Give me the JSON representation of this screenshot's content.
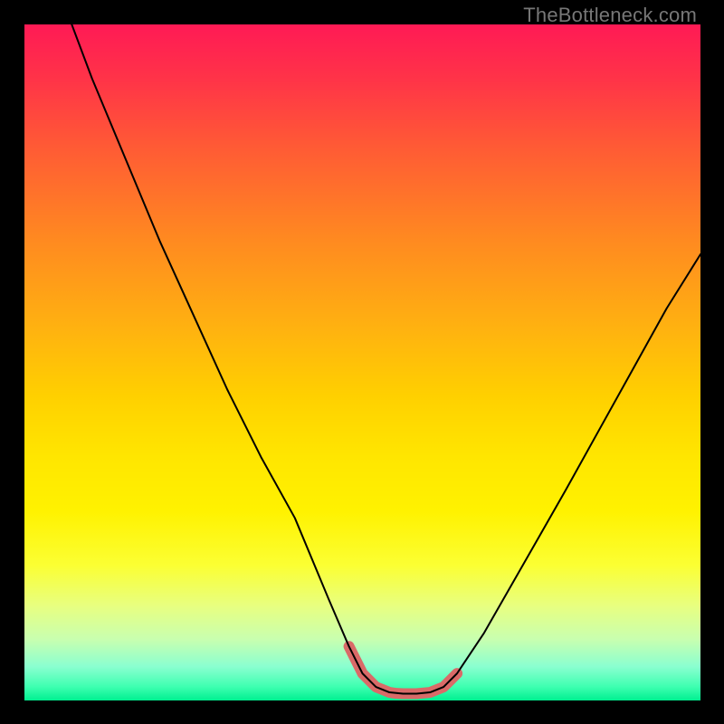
{
  "attribution": "TheBottleneck.com",
  "colors": {
    "frame": "#000000",
    "curve": "#000000",
    "marker": "#d96a68",
    "gradient_top": "#ff1a55",
    "gradient_bottom": "#00f090"
  },
  "chart_data": {
    "type": "line",
    "title": "",
    "xlabel": "",
    "ylabel": "",
    "xlim": [
      0,
      100
    ],
    "ylim": [
      0,
      100
    ],
    "series": [
      {
        "name": "bottleneck-curve",
        "x": [
          7,
          10,
          15,
          20,
          25,
          30,
          35,
          40,
          45,
          48,
          50,
          52,
          54,
          56,
          58,
          60,
          62,
          64,
          68,
          72,
          76,
          80,
          85,
          90,
          95,
          100
        ],
        "y": [
          100,
          92,
          80,
          68,
          57,
          46,
          36,
          27,
          15,
          8,
          4,
          2,
          1.2,
          1,
          1,
          1.2,
          2,
          4,
          10,
          17,
          24,
          31,
          40,
          49,
          58,
          66
        ]
      }
    ],
    "marker_region": {
      "name": "optimal-zone",
      "x": [
        48,
        50,
        52,
        54,
        55,
        56,
        58,
        60,
        62,
        63,
        64
      ],
      "y": [
        8,
        4,
        2,
        1.2,
        1.05,
        1,
        1,
        1.2,
        2,
        3,
        4
      ]
    }
  }
}
